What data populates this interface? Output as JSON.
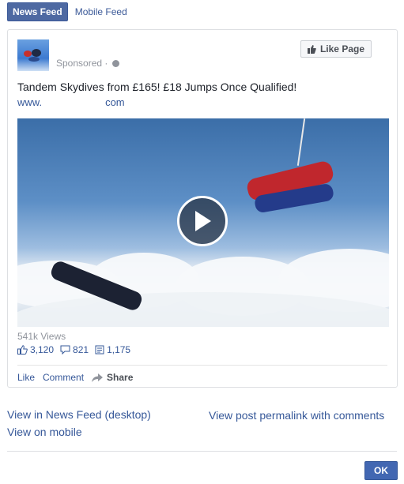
{
  "tabs": {
    "active": "News Feed",
    "inactive": "Mobile Feed"
  },
  "post": {
    "sponsored_label": "Sponsored ·",
    "like_page_label": "Like Page",
    "headline": "Tandem Skydives from £165! £18 Jumps Once Qualified!",
    "url_prefix": "www.",
    "url_suffix": "com",
    "views": "541k Views",
    "likes": "3,120",
    "comments_count": "821",
    "shares_count": "1,175",
    "actions": {
      "like": "Like",
      "comment": "Comment",
      "share": "Share"
    }
  },
  "links": {
    "view_desktop": "View in News Feed (desktop)",
    "view_mobile": "View on mobile",
    "view_permalink": "View post permalink with comments"
  },
  "footer": {
    "ok_label": "OK"
  },
  "colors": {
    "brand": "#4267b2",
    "link": "#365899",
    "muted": "#90949c"
  }
}
